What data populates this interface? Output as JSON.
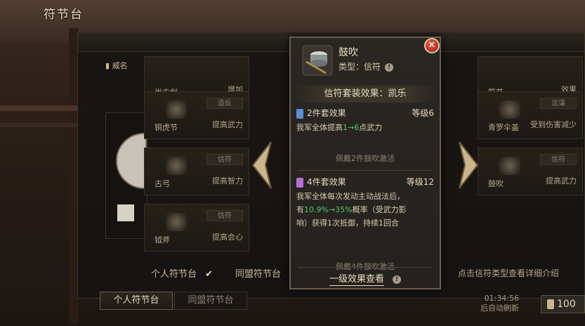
{
  "page": {
    "title": "符节台"
  },
  "side_tag": "威名",
  "grid_cells": [
    {
      "name": "尚方剑",
      "tag": "",
      "effect": "增加"
    },
    {
      "name": "铜虎节",
      "tag": "造反",
      "effect": "提高武力"
    },
    {
      "name": "古弓",
      "tag": "信符",
      "effect": "提高智力"
    },
    {
      "name": "钺斧",
      "tag": "信符",
      "effect": "提高会心"
    },
    {
      "name": "符节",
      "tag": "",
      "effect": "效果"
    },
    {
      "name": "青罗伞盖",
      "tag": "议谋",
      "effect": "受到伤害减少"
    },
    {
      "name": "鼓吹",
      "tag": "信符",
      "effect": "提高武力"
    }
  ],
  "popup": {
    "item_name": "鼓吹",
    "type_label": "类型：信符",
    "set_header": "信符套装效果：凯乐",
    "tier2": {
      "title": "2件套效果",
      "level": "等级6",
      "desc_prefix": "我军全体提高",
      "desc_highlight": "1→6",
      "desc_suffix": "点武力",
      "activation": "佩戴2件鼓吹激活",
      "gem_color": "#5b8fd8"
    },
    "tier4": {
      "title": "4件套效果",
      "level": "等级12",
      "desc_line1": "我军全体每次发动主动战法后，",
      "desc_line2_prefix": "有",
      "desc_line2_highlight": "10.9%→35%",
      "desc_line2_suffix": "概率（受武力影",
      "desc_line3": "响）获得1次抵御，持续1回合",
      "activation": "佩戴4件鼓吹激活",
      "gem_color": "#b770d6"
    },
    "detail_link": "一级效果查看",
    "close_icon": "close-icon"
  },
  "bottom": {
    "personal_toggle": "个人符节台",
    "alliance_toggle": "同盟符节台",
    "tip": "点击信符类型查看详细介绍",
    "tab_personal": "个人符节台",
    "tab_alliance": "同盟符节台",
    "timer": "01:34:56",
    "refresh_label": "后自动刷新",
    "currency_amount": "100"
  },
  "colors": {
    "accent_text": "#efe2c4",
    "highlight_green": "#52c56a",
    "close_red": "#c0392b"
  }
}
